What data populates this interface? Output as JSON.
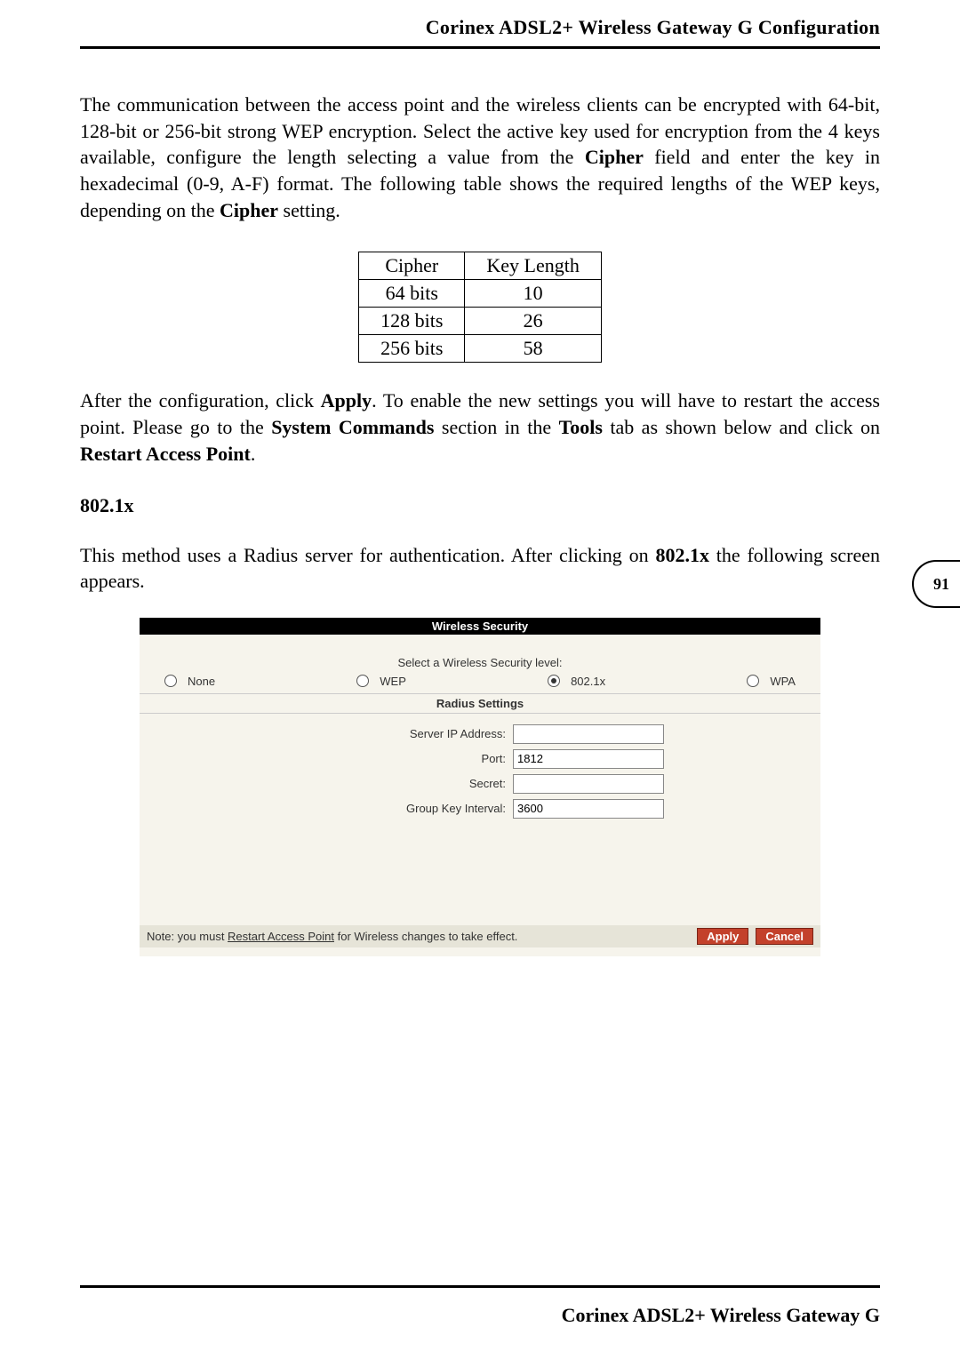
{
  "header": {
    "title": "Corinex ADSL2+ Wireless Gateway G Configuration"
  },
  "para1_pre": "The communication between the access point and the wireless clients can be encrypted with 64-bit, 128-bit or 256-bit strong WEP encryption. Select the active key used for encryption from the 4 keys available, configure the length selecting a value from the ",
  "para1_b1": "Cipher",
  "para1_mid": " field and enter the key in hexadecimal (0-9, A-F) format. The following table shows the required lengths of the WEP keys, depending on the ",
  "para1_b2": "Cipher",
  "para1_end": " setting.",
  "table": {
    "headers": [
      "Cipher",
      "Key Length"
    ],
    "rows": [
      [
        "64 bits",
        "10"
      ],
      [
        "128 bits",
        "26"
      ],
      [
        "256 bits",
        "58"
      ]
    ]
  },
  "para2": {
    "p1": "After the configuration, click ",
    "b1": "Apply",
    "p2": ". To enable the new settings you will have to restart the access point. Please go to the ",
    "b2": "System Commands",
    "p3": " section in the ",
    "b3": "Tools",
    "p4": " tab as shown below and click on ",
    "b4": "Restart Access Point",
    "p5": "."
  },
  "section_heading": "802.1x",
  "para3": {
    "p1": "This method uses a Radius server for authentication. After clicking on ",
    "b1": "802.1x",
    "p2": " the following screen appears."
  },
  "page_number": "91",
  "screenshot": {
    "title": "Wireless Security",
    "select_label": "Select a Wireless Security level:",
    "radios": {
      "none": "None",
      "wep": "WEP",
      "x8021": "802.1x",
      "wpa": "WPA",
      "selected": "x8021"
    },
    "sub_heading": "Radius Settings",
    "fields": {
      "server_ip_label": "Server IP Address:",
      "server_ip_value": "",
      "port_label": "Port:",
      "port_value": "1812",
      "secret_label": "Secret:",
      "secret_value": "",
      "gki_label": "Group Key Interval:",
      "gki_value": "3600"
    },
    "note_prefix": "Note: you must ",
    "note_link": "Restart Access Point",
    "note_suffix": " for Wireless changes to take effect.",
    "apply": "Apply",
    "cancel": "Cancel"
  },
  "footer": "Corinex ADSL2+ Wireless Gateway G"
}
